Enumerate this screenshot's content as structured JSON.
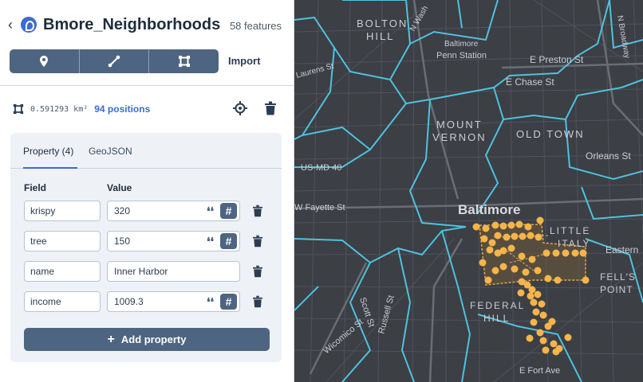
{
  "header": {
    "title": "Bmore_Neighborhoods",
    "feature_count": "58 features",
    "import_label": "Import"
  },
  "feature": {
    "area": "0.591293 km²",
    "positions": "94 positions"
  },
  "properties": {
    "tabs": [
      "Property (4)",
      "GeoJSON"
    ],
    "field_header": "Field",
    "value_header": "Value",
    "rows": [
      {
        "field": "krispy",
        "value": "320",
        "numeric": true
      },
      {
        "field": "tree",
        "value": "150",
        "numeric": true
      },
      {
        "field": "name",
        "value": "Inner Harbor",
        "numeric": false
      },
      {
        "field": "income",
        "value": "1009.3",
        "numeric": true
      }
    ],
    "add_label": "Add property"
  },
  "map": {
    "labels": {
      "bolton": "BOLTON",
      "hill": "HILL",
      "penn1": "Baltimore",
      "penn2": "Penn Station",
      "preston": "E Preston St",
      "chase": "E Chase St",
      "mount": "MOUNT",
      "vernon": "VERNON",
      "oldtown": "OLD TOWN",
      "orleans": "Orleans St",
      "usmd": "US-MD 40",
      "fayette": "W Fayette St",
      "baltimore": "Baltimore",
      "little": "LITTLE",
      "italy": "ITALY",
      "eastern": "Eastern",
      "fells": "FELL'S",
      "point": "POINT",
      "federal": "FEDERAL",
      "fhill": "HILL",
      "scott": "Scott St",
      "russell": "Russell St",
      "wicomico": "Wicomico St",
      "fortave": "E Fort Ave",
      "nbroadway": "N Broadway",
      "nwash": "N Wash",
      "laurens": "Laurens St"
    },
    "colors": {
      "background": "#3c3f44",
      "boundary": "#4fc1e0",
      "street": "#55595f",
      "point": "#f5b54a",
      "selection": "#e4a94e"
    }
  }
}
